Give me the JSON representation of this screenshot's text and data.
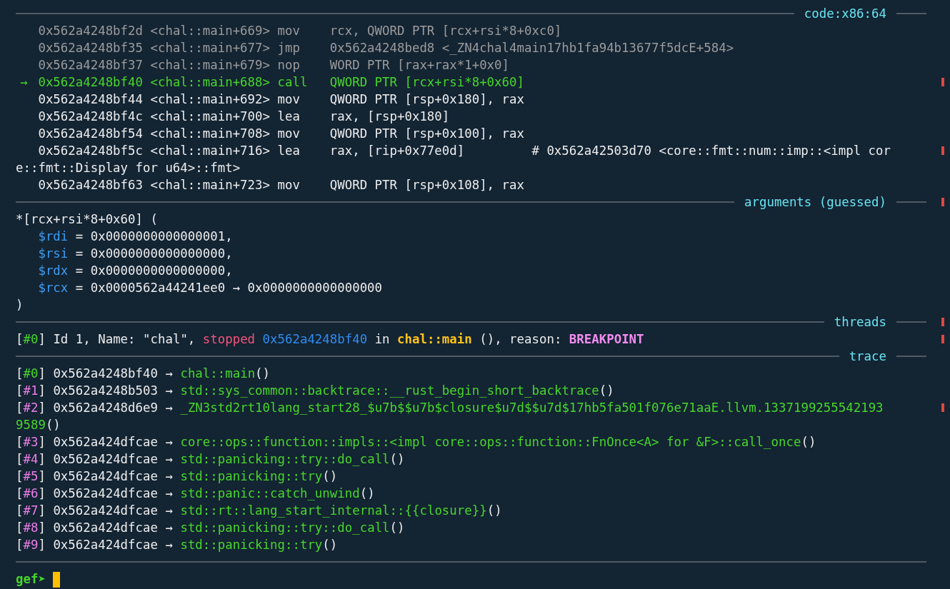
{
  "code": {
    "title": "code:x86:64",
    "lines": [
      {
        "kind": "past",
        "address": "0x562a4248bf2d",
        "symbol": "<chal::main+669>",
        "mnemonic": "mov",
        "operands": "rcx, QWORD PTR [rcx+rsi*8+0xc0]"
      },
      {
        "kind": "past",
        "address": "0x562a4248bf35",
        "symbol": "<chal::main+677>",
        "mnemonic": "jmp",
        "operands": "0x562a4248bed8 <_ZN4chal4main17hb1fa94b13677f5dcE+584>"
      },
      {
        "kind": "past",
        "address": "0x562a4248bf37",
        "symbol": "<chal::main+679>",
        "mnemonic": "nop",
        "operands": "WORD PTR [rax+rax*1+0x0]"
      },
      {
        "kind": "current",
        "marker": "→",
        "address": "0x562a4248bf40",
        "symbol": "<chal::main+688>",
        "mnemonic": "call",
        "operands": "QWORD PTR [rcx+rsi*8+0x60]"
      },
      {
        "kind": "upcoming",
        "address": "0x562a4248bf44",
        "symbol": "<chal::main+692>",
        "mnemonic": "mov",
        "operands": "QWORD PTR [rsp+0x180], rax"
      },
      {
        "kind": "upcoming",
        "address": "0x562a4248bf4c",
        "symbol": "<chal::main+700>",
        "mnemonic": "lea",
        "operands": "rax, [rsp+0x180]"
      },
      {
        "kind": "upcoming",
        "address": "0x562a4248bf54",
        "symbol": "<chal::main+708>",
        "mnemonic": "mov",
        "operands": "QWORD PTR [rsp+0x100], rax"
      },
      {
        "kind": "upcoming",
        "address": "0x562a4248bf5c",
        "symbol": "<chal::main+716>",
        "mnemonic": "lea",
        "operands": "rax, [rip+0x77e0d]",
        "comment": "# 0x562a42503d70 <core::fmt::num::imp::<impl cor",
        "comment_wrap": "e::fmt::Display for u64>::fmt>"
      },
      {
        "kind": "upcoming",
        "address": "0x562a4248bf63",
        "symbol": "<chal::main+723>",
        "mnemonic": "mov",
        "operands": "QWORD PTR [rsp+0x108], rax"
      }
    ]
  },
  "arguments": {
    "title": "arguments (guessed)",
    "call": "*[rcx+rsi*8+0x60] (",
    "args": [
      {
        "register": "$rdi",
        "value": "= 0x0000000000000001,"
      },
      {
        "register": "$rsi",
        "value": "= 0x0000000000000000,"
      },
      {
        "register": "$rdx",
        "value": "= 0x0000000000000000,"
      },
      {
        "register": "$rcx",
        "value": "= 0x0000562a44241ee0 → 0x0000000000000000"
      }
    ],
    "close": ")"
  },
  "threads": {
    "title": "threads",
    "items": [
      {
        "index": {
          "open": "[",
          "label": "#0",
          "close": "]"
        },
        "parts": [
          {
            "kind": "text",
            "text": "Id 1, Name: \"chal\","
          },
          {
            "kind": "status",
            "text": "stopped"
          },
          {
            "kind": "address",
            "text": "0x562a4248bf40"
          },
          {
            "kind": "text",
            "text": "in"
          },
          {
            "kind": "function",
            "text": "chal::main"
          },
          {
            "kind": "text",
            "text": "(), reason:"
          },
          {
            "kind": "reason",
            "text": "BREAKPOINT"
          }
        ]
      }
    ]
  },
  "trace": {
    "title": "trace",
    "frames": [
      {
        "index": {
          "open": "[",
          "label": "#0",
          "close": "]"
        },
        "address": "0x562a4248bf40",
        "arrow": "→",
        "function": "chal::main",
        "call": "()"
      },
      {
        "index": {
          "open": "[",
          "label": "#1",
          "close": "]"
        },
        "address": "0x562a4248b503",
        "arrow": "→",
        "function": "std::sys_common::backtrace::__rust_begin_short_backtrace",
        "call": "()"
      },
      {
        "index": {
          "open": "[",
          "label": "#2",
          "close": "]"
        },
        "address": "0x562a4248d6e9",
        "arrow": "→",
        "function": "_ZN3std2rt10lang_start28_$u7b$$u7b$closure$u7d$$u7d$17hb5fa501f076e71aaE.llvm.1337199255542193",
        "function_wrap": "9589",
        "call": "()"
      },
      {
        "index": {
          "open": "[",
          "label": "#3",
          "close": "]"
        },
        "address": "0x562a424dfcae",
        "arrow": "→",
        "function": "core::ops::function::impls::<impl core::ops::function::FnOnce<A> for &F>::call_once",
        "call": "()"
      },
      {
        "index": {
          "open": "[",
          "label": "#4",
          "close": "]"
        },
        "address": "0x562a424dfcae",
        "arrow": "→",
        "function": "std::panicking::try::do_call",
        "call": "()"
      },
      {
        "index": {
          "open": "[",
          "label": "#5",
          "close": "]"
        },
        "address": "0x562a424dfcae",
        "arrow": "→",
        "function": "std::panicking::try",
        "call": "()"
      },
      {
        "index": {
          "open": "[",
          "label": "#6",
          "close": "]"
        },
        "address": "0x562a424dfcae",
        "arrow": "→",
        "function": "std::panic::catch_unwind",
        "call": "()"
      },
      {
        "index": {
          "open": "[",
          "label": "#7",
          "close": "]"
        },
        "address": "0x562a424dfcae",
        "arrow": "→",
        "function": "std::rt::lang_start_internal::{{closure}}",
        "call": "()"
      },
      {
        "index": {
          "open": "[",
          "label": "#8",
          "close": "]"
        },
        "address": "0x562a424dfcae",
        "arrow": "→",
        "function": "std::panicking::try::do_call",
        "call": "()"
      },
      {
        "index": {
          "open": "[",
          "label": "#9",
          "close": "]"
        },
        "address": "0x562a424dfcae",
        "arrow": "→",
        "function": "std::panicking::try",
        "call": "()"
      }
    ]
  },
  "prompt": {
    "text": "gef➤"
  }
}
